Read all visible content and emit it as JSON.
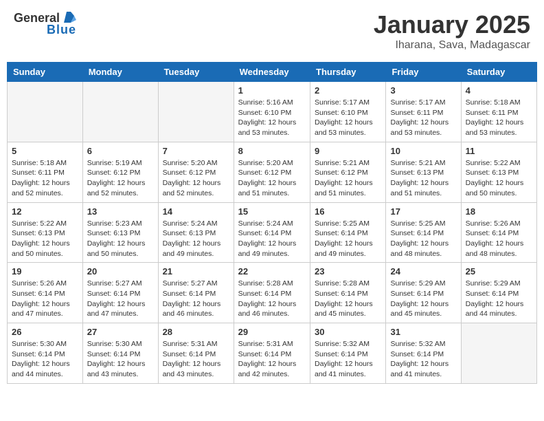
{
  "header": {
    "logo_general": "General",
    "logo_blue": "Blue",
    "title": "January 2025",
    "subtitle": "Iharana, Sava, Madagascar"
  },
  "weekdays": [
    "Sunday",
    "Monday",
    "Tuesday",
    "Wednesday",
    "Thursday",
    "Friday",
    "Saturday"
  ],
  "weeks": [
    [
      {
        "day": "",
        "info": ""
      },
      {
        "day": "",
        "info": ""
      },
      {
        "day": "",
        "info": ""
      },
      {
        "day": "1",
        "info": "Sunrise: 5:16 AM\nSunset: 6:10 PM\nDaylight: 12 hours\nand 53 minutes."
      },
      {
        "day": "2",
        "info": "Sunrise: 5:17 AM\nSunset: 6:10 PM\nDaylight: 12 hours\nand 53 minutes."
      },
      {
        "day": "3",
        "info": "Sunrise: 5:17 AM\nSunset: 6:11 PM\nDaylight: 12 hours\nand 53 minutes."
      },
      {
        "day": "4",
        "info": "Sunrise: 5:18 AM\nSunset: 6:11 PM\nDaylight: 12 hours\nand 53 minutes."
      }
    ],
    [
      {
        "day": "5",
        "info": "Sunrise: 5:18 AM\nSunset: 6:11 PM\nDaylight: 12 hours\nand 52 minutes."
      },
      {
        "day": "6",
        "info": "Sunrise: 5:19 AM\nSunset: 6:12 PM\nDaylight: 12 hours\nand 52 minutes."
      },
      {
        "day": "7",
        "info": "Sunrise: 5:20 AM\nSunset: 6:12 PM\nDaylight: 12 hours\nand 52 minutes."
      },
      {
        "day": "8",
        "info": "Sunrise: 5:20 AM\nSunset: 6:12 PM\nDaylight: 12 hours\nand 51 minutes."
      },
      {
        "day": "9",
        "info": "Sunrise: 5:21 AM\nSunset: 6:12 PM\nDaylight: 12 hours\nand 51 minutes."
      },
      {
        "day": "10",
        "info": "Sunrise: 5:21 AM\nSunset: 6:13 PM\nDaylight: 12 hours\nand 51 minutes."
      },
      {
        "day": "11",
        "info": "Sunrise: 5:22 AM\nSunset: 6:13 PM\nDaylight: 12 hours\nand 50 minutes."
      }
    ],
    [
      {
        "day": "12",
        "info": "Sunrise: 5:22 AM\nSunset: 6:13 PM\nDaylight: 12 hours\nand 50 minutes."
      },
      {
        "day": "13",
        "info": "Sunrise: 5:23 AM\nSunset: 6:13 PM\nDaylight: 12 hours\nand 50 minutes."
      },
      {
        "day": "14",
        "info": "Sunrise: 5:24 AM\nSunset: 6:13 PM\nDaylight: 12 hours\nand 49 minutes."
      },
      {
        "day": "15",
        "info": "Sunrise: 5:24 AM\nSunset: 6:14 PM\nDaylight: 12 hours\nand 49 minutes."
      },
      {
        "day": "16",
        "info": "Sunrise: 5:25 AM\nSunset: 6:14 PM\nDaylight: 12 hours\nand 49 minutes."
      },
      {
        "day": "17",
        "info": "Sunrise: 5:25 AM\nSunset: 6:14 PM\nDaylight: 12 hours\nand 48 minutes."
      },
      {
        "day": "18",
        "info": "Sunrise: 5:26 AM\nSunset: 6:14 PM\nDaylight: 12 hours\nand 48 minutes."
      }
    ],
    [
      {
        "day": "19",
        "info": "Sunrise: 5:26 AM\nSunset: 6:14 PM\nDaylight: 12 hours\nand 47 minutes."
      },
      {
        "day": "20",
        "info": "Sunrise: 5:27 AM\nSunset: 6:14 PM\nDaylight: 12 hours\nand 47 minutes."
      },
      {
        "day": "21",
        "info": "Sunrise: 5:27 AM\nSunset: 6:14 PM\nDaylight: 12 hours\nand 46 minutes."
      },
      {
        "day": "22",
        "info": "Sunrise: 5:28 AM\nSunset: 6:14 PM\nDaylight: 12 hours\nand 46 minutes."
      },
      {
        "day": "23",
        "info": "Sunrise: 5:28 AM\nSunset: 6:14 PM\nDaylight: 12 hours\nand 45 minutes."
      },
      {
        "day": "24",
        "info": "Sunrise: 5:29 AM\nSunset: 6:14 PM\nDaylight: 12 hours\nand 45 minutes."
      },
      {
        "day": "25",
        "info": "Sunrise: 5:29 AM\nSunset: 6:14 PM\nDaylight: 12 hours\nand 44 minutes."
      }
    ],
    [
      {
        "day": "26",
        "info": "Sunrise: 5:30 AM\nSunset: 6:14 PM\nDaylight: 12 hours\nand 44 minutes."
      },
      {
        "day": "27",
        "info": "Sunrise: 5:30 AM\nSunset: 6:14 PM\nDaylight: 12 hours\nand 43 minutes."
      },
      {
        "day": "28",
        "info": "Sunrise: 5:31 AM\nSunset: 6:14 PM\nDaylight: 12 hours\nand 43 minutes."
      },
      {
        "day": "29",
        "info": "Sunrise: 5:31 AM\nSunset: 6:14 PM\nDaylight: 12 hours\nand 42 minutes."
      },
      {
        "day": "30",
        "info": "Sunrise: 5:32 AM\nSunset: 6:14 PM\nDaylight: 12 hours\nand 41 minutes."
      },
      {
        "day": "31",
        "info": "Sunrise: 5:32 AM\nSunset: 6:14 PM\nDaylight: 12 hours\nand 41 minutes."
      },
      {
        "day": "",
        "info": ""
      }
    ]
  ]
}
